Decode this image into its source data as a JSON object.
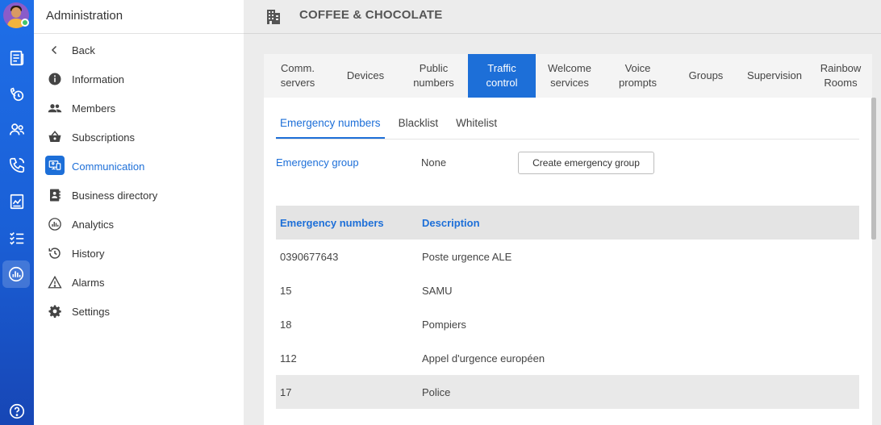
{
  "app": {
    "section_title": "Administration",
    "company_name": "COFFEE & CHOCOLATE"
  },
  "rail": {
    "icons": [
      "news-icon",
      "clock-call-icon",
      "contacts-icon",
      "phone-icon",
      "chart-icon",
      "checklist-icon",
      "analytics-icon",
      "help-icon"
    ],
    "accent": "#1f6fe8"
  },
  "sidebar": {
    "items": [
      {
        "label": "Back",
        "icon": "chevron-left-icon"
      },
      {
        "label": "Information",
        "icon": "info-icon"
      },
      {
        "label": "Members",
        "icon": "members-icon"
      },
      {
        "label": "Subscriptions",
        "icon": "basket-icon"
      },
      {
        "label": "Communication",
        "icon": "communication-icon"
      },
      {
        "label": "Business directory",
        "icon": "directory-icon"
      },
      {
        "label": "Analytics",
        "icon": "analytics-icon"
      },
      {
        "label": "History",
        "icon": "history-icon"
      },
      {
        "label": "Alarms",
        "icon": "warning-icon"
      },
      {
        "label": "Settings",
        "icon": "gear-icon"
      }
    ],
    "active": "Communication"
  },
  "tabs": [
    {
      "line1": "Comm.",
      "line2": "servers"
    },
    {
      "line1": "Devices",
      "line2": ""
    },
    {
      "line1": "Public",
      "line2": "numbers"
    },
    {
      "line1": "Traffic",
      "line2": "control"
    },
    {
      "line1": "Welcome",
      "line2": "services"
    },
    {
      "line1": "Voice",
      "line2": "prompts"
    },
    {
      "line1": "Groups",
      "line2": ""
    },
    {
      "line1": "Supervision",
      "line2": ""
    },
    {
      "line1": "Rainbow",
      "line2": "Rooms"
    }
  ],
  "active_tab": "Traffic control",
  "subtabs": [
    "Emergency numbers",
    "Blacklist",
    "Whitelist"
  ],
  "active_subtab": "Emergency numbers",
  "emergency_group": {
    "label": "Emergency group",
    "value": "None",
    "button": "Create emergency group"
  },
  "table": {
    "headers": [
      "Emergency numbers",
      "Description"
    ],
    "rows": [
      {
        "number": "0390677643",
        "description": "Poste urgence ALE"
      },
      {
        "number": "15",
        "description": "SAMU"
      },
      {
        "number": "18",
        "description": "Pompiers"
      },
      {
        "number": "112",
        "description": "Appel d'urgence européen"
      },
      {
        "number": "17",
        "description": "Police"
      }
    ]
  },
  "colors": {
    "primary": "#1d6fd8",
    "background": "#ececec"
  }
}
